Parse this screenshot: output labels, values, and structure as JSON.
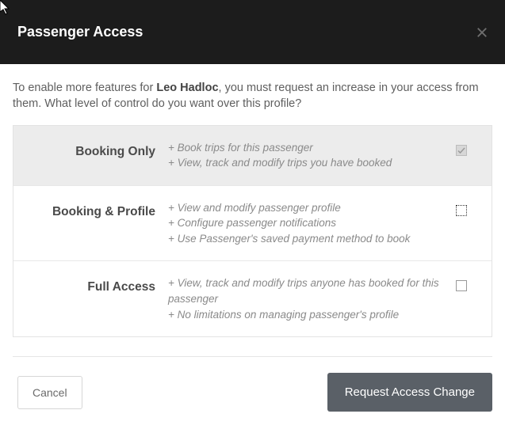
{
  "header": {
    "title": "Passenger Access"
  },
  "intro": {
    "prefix": "To enable more features for ",
    "name": "Leo Hadloc",
    "suffix": ", you must request an increase in your access from them. What level of control do you want over this profile?"
  },
  "options": [
    {
      "label": "Booking Only",
      "desc": [
        "Book trips for this passenger",
        "View, track and modify trips you have booked"
      ],
      "checked": true,
      "disabled": true,
      "dotted": false
    },
    {
      "label": "Booking & Profile",
      "desc": [
        "View and modify passenger profile",
        "Configure passenger notifications",
        "Use Passenger's saved payment method to book"
      ],
      "checked": false,
      "disabled": false,
      "dotted": true
    },
    {
      "label": "Full Access",
      "desc": [
        "View, track and modify trips anyone has booked for this passenger",
        "No limitations on managing passenger's profile"
      ],
      "checked": false,
      "disabled": false,
      "dotted": false
    }
  ],
  "footer": {
    "cancel": "Cancel",
    "submit": "Request Access Change"
  }
}
